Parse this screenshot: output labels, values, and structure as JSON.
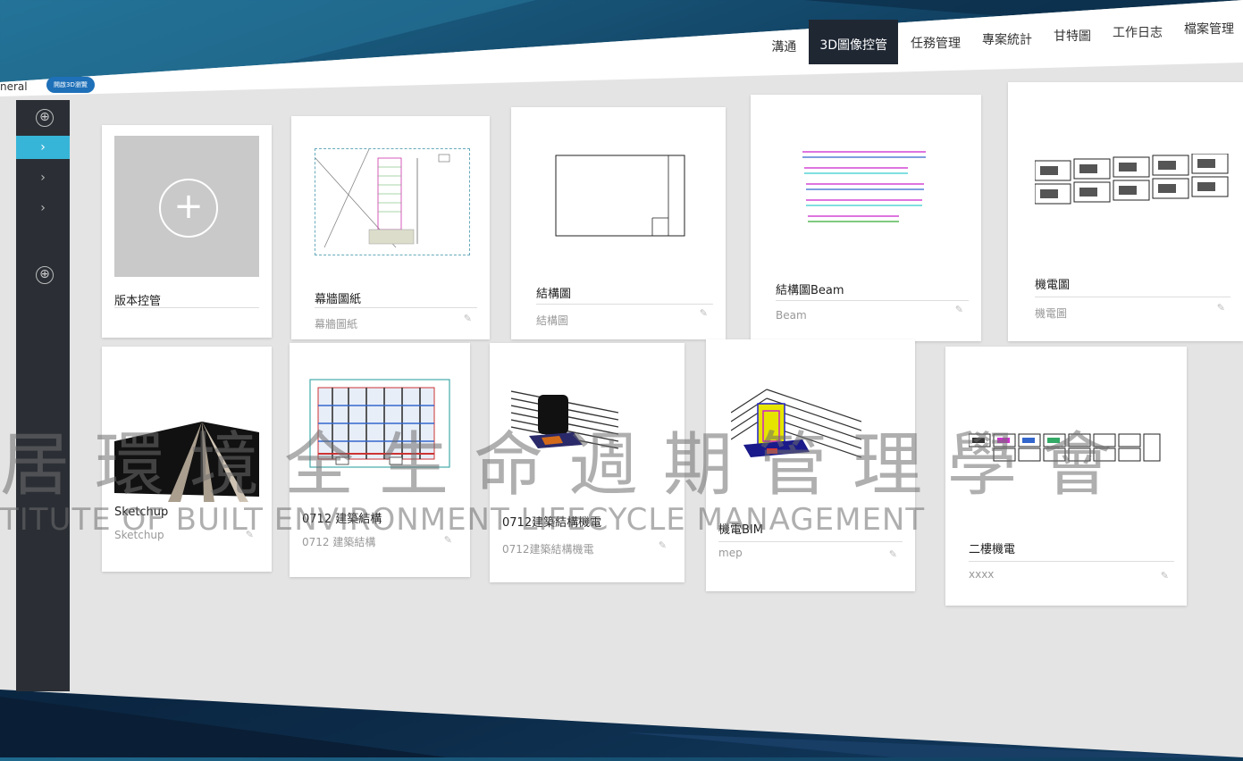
{
  "nav": {
    "tabs": [
      {
        "label": "溝通"
      },
      {
        "label": "3D圖像控管"
      },
      {
        "label": "任務管理"
      },
      {
        "label": "專案統計"
      },
      {
        "label": "甘特圖"
      },
      {
        "label": "工作日志"
      },
      {
        "label": "檔案管理"
      }
    ],
    "active_index": 1
  },
  "project": {
    "label": "neral",
    "button": "開啟3D瀏覽"
  },
  "sidebar": {
    "items": [
      "⊕",
      "›",
      "›",
      "›",
      "⊕"
    ]
  },
  "cards": [
    {
      "title": "版本控管",
      "subtitle": ""
    },
    {
      "title": "幕牆圖紙",
      "subtitle": "幕牆圖紙"
    },
    {
      "title": "結構圖",
      "subtitle": "結構圖"
    },
    {
      "title": "結構圖Beam",
      "subtitle": "Beam"
    },
    {
      "title": "機電圖",
      "subtitle": "機電圖"
    },
    {
      "title": "Sketchup",
      "subtitle": "Sketchup"
    },
    {
      "title": "0712 建築結構",
      "subtitle": "0712 建築結構"
    },
    {
      "title": "0712建築結構機電",
      "subtitle": "0712建築結構機電"
    },
    {
      "title": "機電BIM",
      "subtitle": "mep"
    },
    {
      "title": "二樓機電",
      "subtitle": "xxxx"
    }
  ],
  "watermark": {
    "cn": "居環境全生命週期管理學會",
    "en": "TITUTE OF BUILT ENVIRONMENT LIFECYCLE MANAGEMENT"
  },
  "colors": {
    "active_tab": "#1f2733",
    "accent": "#37b5d8",
    "button": "#1e70b8"
  }
}
